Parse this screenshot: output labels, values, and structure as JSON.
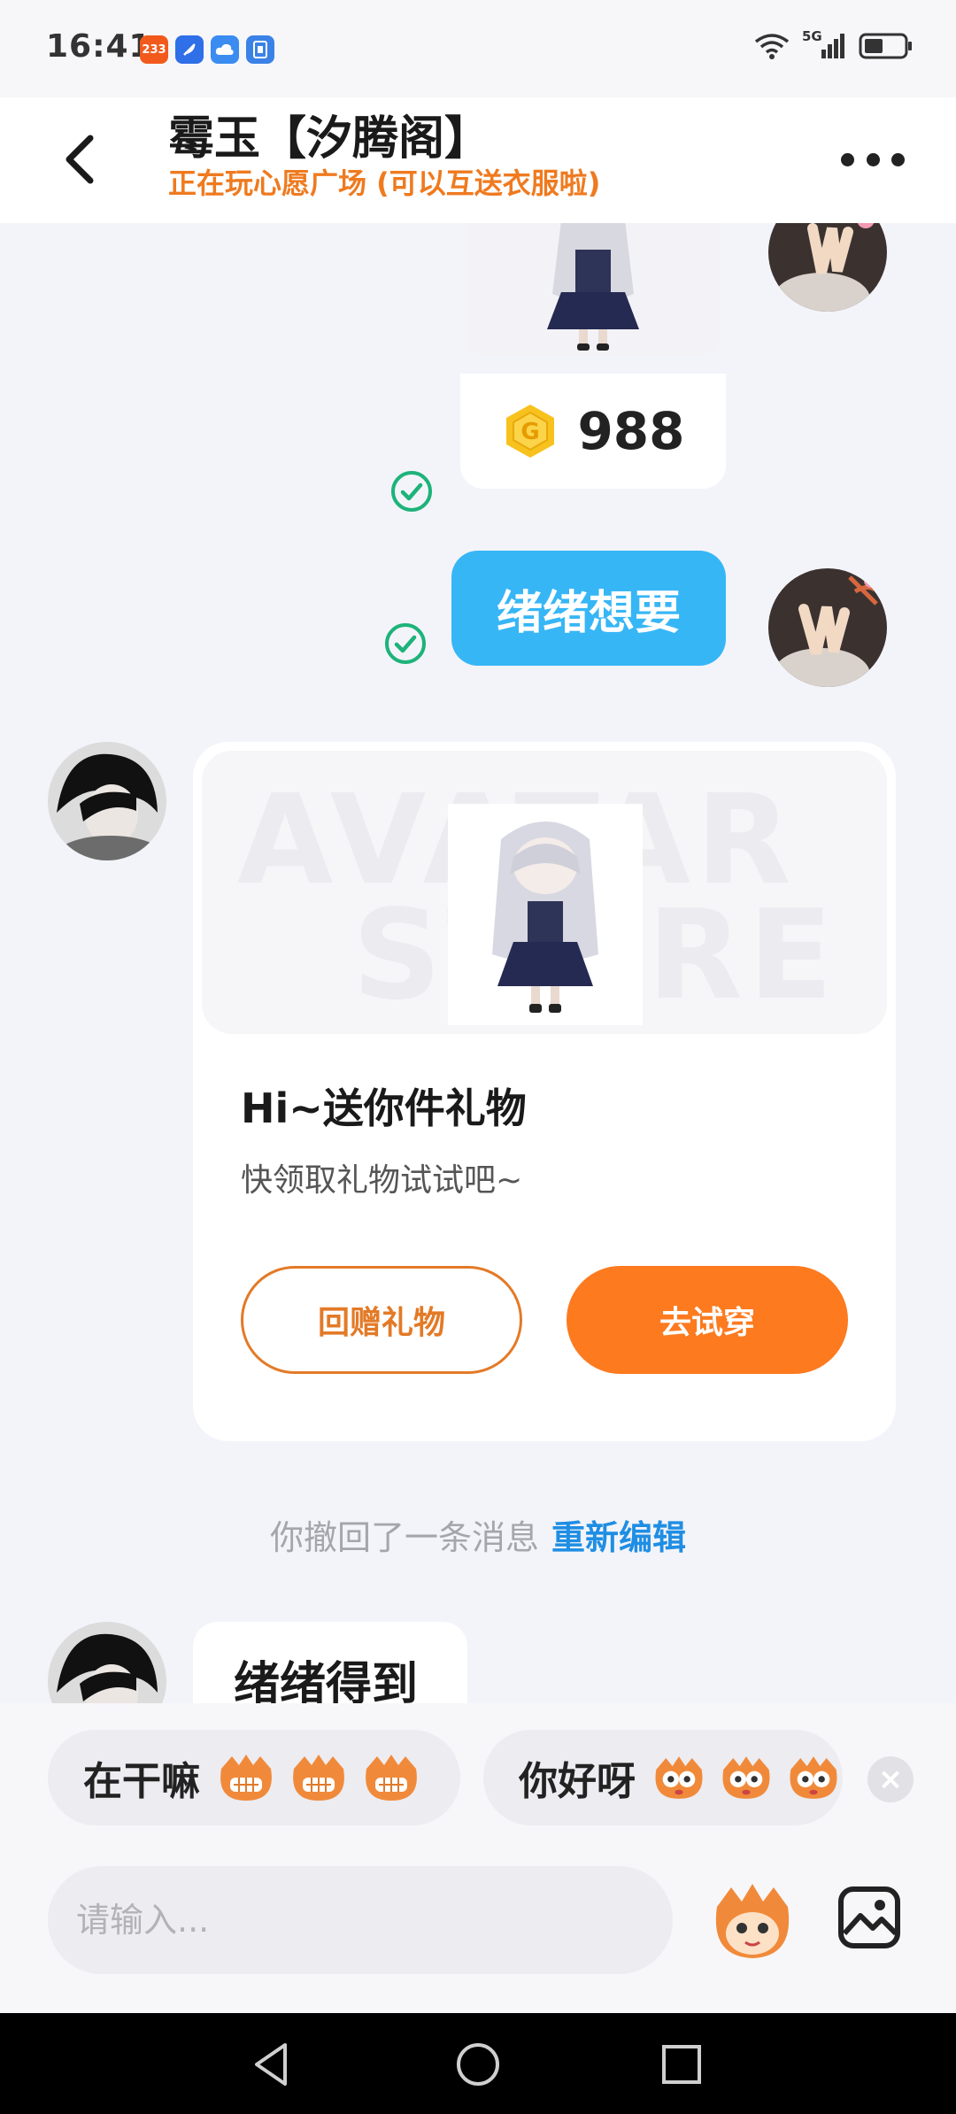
{
  "status_bar": {
    "time": "16:41",
    "app_badge": "233",
    "network": "5G"
  },
  "header": {
    "title": "霉玉【汐腾阁】",
    "subtitle": "正在玩心愿广场 (可以互送衣服啦)"
  },
  "messages": {
    "gift_price": "988",
    "sent_text": "绪绪想要",
    "gift_card": {
      "watermark_line1": "AVATAR",
      "watermark_line2": "STORE",
      "title": "Hi~送你件礼物",
      "subtitle": "快领取礼物试试吧~",
      "return_gift_label": "回赠礼物",
      "try_on_label": "去试穿"
    },
    "recall_text": "你撤回了一条消息",
    "recall_edit_label": "重新编辑",
    "received_text": "绪绪得到"
  },
  "quick_replies": [
    {
      "text": "在干嘛"
    },
    {
      "text": "你好呀"
    }
  ],
  "input": {
    "placeholder": "请输入..."
  },
  "colors": {
    "accent_orange": "#fd7a1f",
    "bubble_blue": "#37b6f6",
    "link_blue": "#1f8ee3",
    "check_green": "#1db37a"
  }
}
